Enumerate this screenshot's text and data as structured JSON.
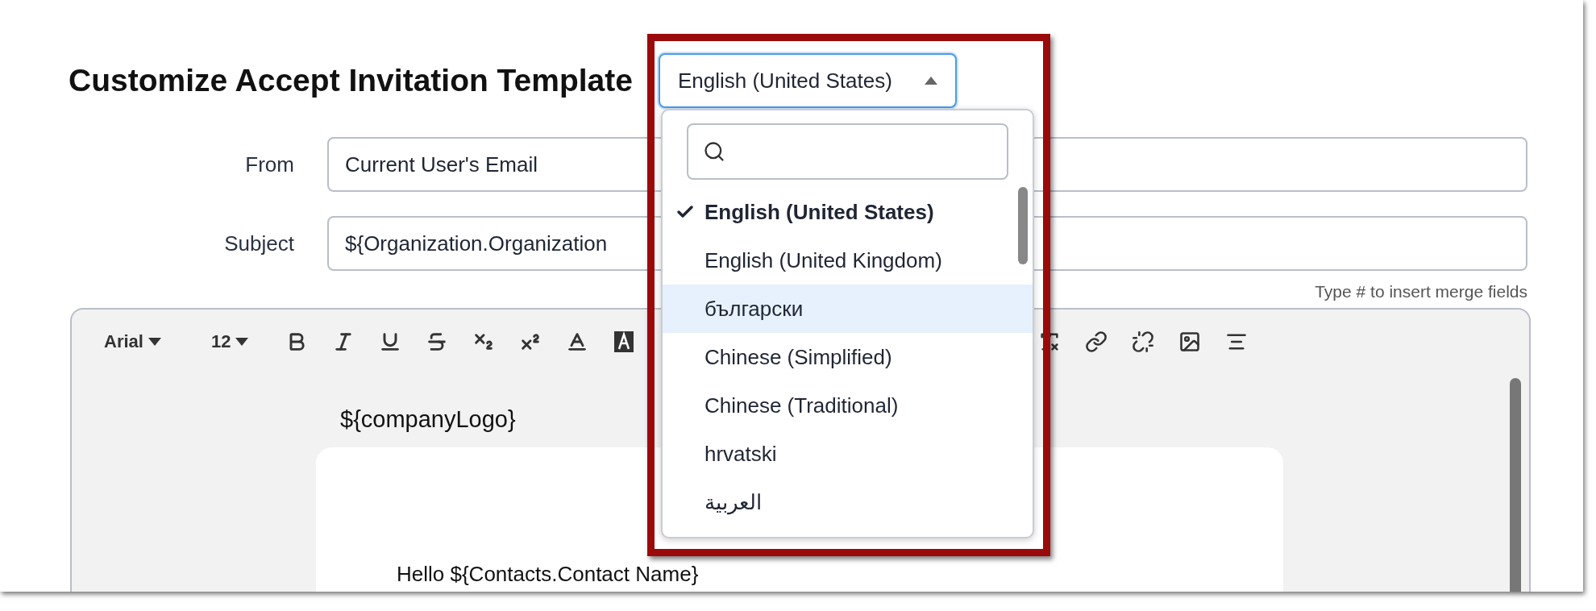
{
  "title": "Customize Accept Invitation Template",
  "language_select": {
    "value": "English (United States)",
    "expanded": true
  },
  "language_menu": {
    "items": [
      {
        "label": "English (United States)",
        "selected": true,
        "highlighted": false
      },
      {
        "label": "English (United Kingdom)",
        "selected": false,
        "highlighted": false
      },
      {
        "label": "български",
        "selected": false,
        "highlighted": true
      },
      {
        "label": "Chinese (Simplified)",
        "selected": false,
        "highlighted": false
      },
      {
        "label": "Chinese (Traditional)",
        "selected": false,
        "highlighted": false
      },
      {
        "label": "hrvatski",
        "selected": false,
        "highlighted": false
      },
      {
        "label": "العربية",
        "selected": false,
        "highlighted": false
      }
    ]
  },
  "fields": [
    {
      "label": "From",
      "value": "Current User's Email"
    },
    {
      "label": "Subject",
      "value": "${Organization.Organization"
    }
  ],
  "hint": "Type # to insert merge fields",
  "toolbar": {
    "font": "Arial",
    "size": "12"
  },
  "editor": {
    "logo_placeholder": "${companyLogo}",
    "greeting": "Hello ${Contacts.Contact Name}"
  }
}
